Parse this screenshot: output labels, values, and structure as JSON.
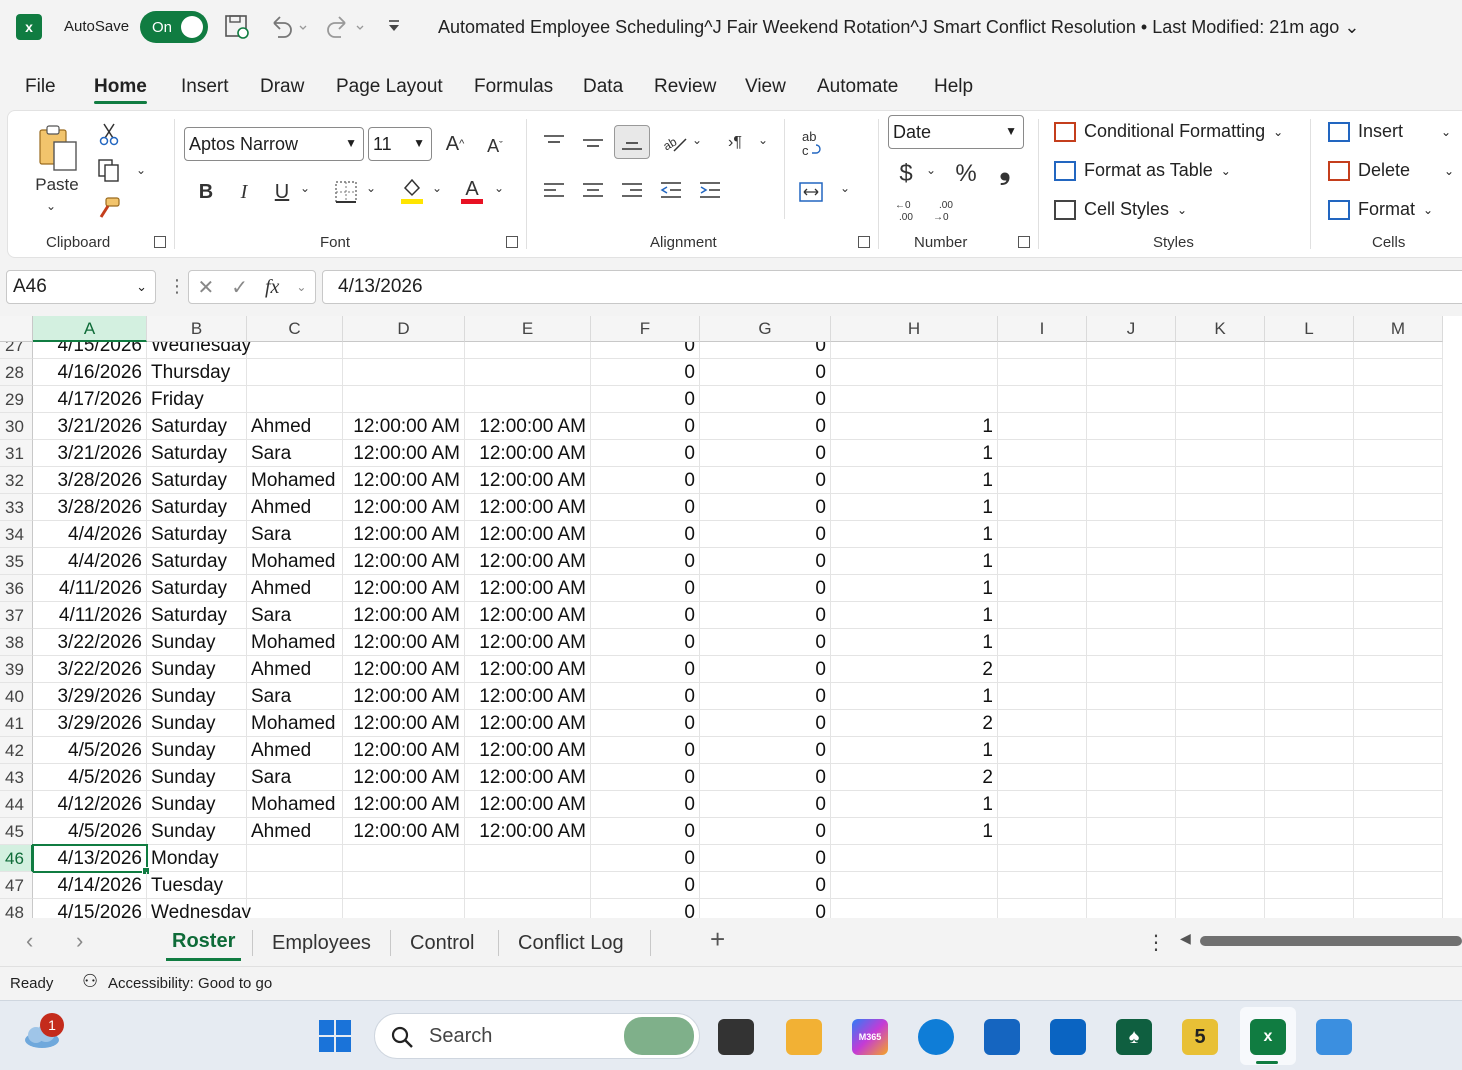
{
  "titlebar": {
    "autosave_label": "AutoSave",
    "autosave_state": "On",
    "document_title": "Automated Employee Scheduling^J  Fair Weekend Rotation^J  Smart Conflict Resolution • Last Modified: 21m ago",
    "title_chevron": "⌄"
  },
  "menu": [
    "File",
    "Home",
    "Insert",
    "Draw",
    "Page Layout",
    "Formulas",
    "Data",
    "Review",
    "View",
    "Automate",
    "Help"
  ],
  "ribbon": {
    "clipboard": {
      "paste": "Paste",
      "label": "Clipboard"
    },
    "font": {
      "name": "Aptos Narrow",
      "size": "11",
      "label": "Font",
      "bold": "B",
      "italic": "I",
      "underline": "U"
    },
    "alignment": {
      "label": "Alignment"
    },
    "number": {
      "format": "Date",
      "label": "Number",
      "currency": "$",
      "percent": "%",
      "comma": "❟"
    },
    "styles": {
      "conditional": "Conditional Formatting",
      "format_table": "Format as Table",
      "cell_styles": "Cell Styles",
      "label": "Styles"
    },
    "cells": {
      "insert": "Insert",
      "delete": "Delete",
      "format": "Format",
      "label": "Cells"
    }
  },
  "formula_bar": {
    "name_box": "A46",
    "value": "4/13/2026",
    "fx": "fx"
  },
  "columns": [
    "A",
    "B",
    "C",
    "D",
    "E",
    "F",
    "G",
    "H",
    "I",
    "J",
    "K",
    "L",
    "M"
  ],
  "rows": [
    {
      "n": "27",
      "a": "4/15/2026",
      "b": "Wednesday",
      "c": "",
      "d": "",
      "e": "",
      "f": "0",
      "g": "0",
      "h": ""
    },
    {
      "n": "28",
      "a": "4/16/2026",
      "b": "Thursday",
      "c": "",
      "d": "",
      "e": "",
      "f": "0",
      "g": "0",
      "h": ""
    },
    {
      "n": "29",
      "a": "4/17/2026",
      "b": "Friday",
      "c": "",
      "d": "",
      "e": "",
      "f": "0",
      "g": "0",
      "h": ""
    },
    {
      "n": "30",
      "a": "3/21/2026",
      "b": "Saturday",
      "c": "Ahmed",
      "d": "12:00:00 AM",
      "e": "12:00:00 AM",
      "f": "0",
      "g": "0",
      "h": "1"
    },
    {
      "n": "31",
      "a": "3/21/2026",
      "b": "Saturday",
      "c": "Sara",
      "d": "12:00:00 AM",
      "e": "12:00:00 AM",
      "f": "0",
      "g": "0",
      "h": "1"
    },
    {
      "n": "32",
      "a": "3/28/2026",
      "b": "Saturday",
      "c": "Mohamed",
      "d": "12:00:00 AM",
      "e": "12:00:00 AM",
      "f": "0",
      "g": "0",
      "h": "1"
    },
    {
      "n": "33",
      "a": "3/28/2026",
      "b": "Saturday",
      "c": "Ahmed",
      "d": "12:00:00 AM",
      "e": "12:00:00 AM",
      "f": "0",
      "g": "0",
      "h": "1"
    },
    {
      "n": "34",
      "a": "4/4/2026",
      "b": "Saturday",
      "c": "Sara",
      "d": "12:00:00 AM",
      "e": "12:00:00 AM",
      "f": "0",
      "g": "0",
      "h": "1"
    },
    {
      "n": "35",
      "a": "4/4/2026",
      "b": "Saturday",
      "c": "Mohamed",
      "d": "12:00:00 AM",
      "e": "12:00:00 AM",
      "f": "0",
      "g": "0",
      "h": "1"
    },
    {
      "n": "36",
      "a": "4/11/2026",
      "b": "Saturday",
      "c": "Ahmed",
      "d": "12:00:00 AM",
      "e": "12:00:00 AM",
      "f": "0",
      "g": "0",
      "h": "1"
    },
    {
      "n": "37",
      "a": "4/11/2026",
      "b": "Saturday",
      "c": "Sara",
      "d": "12:00:00 AM",
      "e": "12:00:00 AM",
      "f": "0",
      "g": "0",
      "h": "1"
    },
    {
      "n": "38",
      "a": "3/22/2026",
      "b": "Sunday",
      "c": "Mohamed",
      "d": "12:00:00 AM",
      "e": "12:00:00 AM",
      "f": "0",
      "g": "0",
      "h": "1"
    },
    {
      "n": "39",
      "a": "3/22/2026",
      "b": "Sunday",
      "c": "Ahmed",
      "d": "12:00:00 AM",
      "e": "12:00:00 AM",
      "f": "0",
      "g": "0",
      "h": "2"
    },
    {
      "n": "40",
      "a": "3/29/2026",
      "b": "Sunday",
      "c": "Sara",
      "d": "12:00:00 AM",
      "e": "12:00:00 AM",
      "f": "0",
      "g": "0",
      "h": "1"
    },
    {
      "n": "41",
      "a": "3/29/2026",
      "b": "Sunday",
      "c": "Mohamed",
      "d": "12:00:00 AM",
      "e": "12:00:00 AM",
      "f": "0",
      "g": "0",
      "h": "2"
    },
    {
      "n": "42",
      "a": "4/5/2026",
      "b": "Sunday",
      "c": "Ahmed",
      "d": "12:00:00 AM",
      "e": "12:00:00 AM",
      "f": "0",
      "g": "0",
      "h": "1"
    },
    {
      "n": "43",
      "a": "4/5/2026",
      "b": "Sunday",
      "c": "Sara",
      "d": "12:00:00 AM",
      "e": "12:00:00 AM",
      "f": "0",
      "g": "0",
      "h": "2"
    },
    {
      "n": "44",
      "a": "4/12/2026",
      "b": "Sunday",
      "c": "Mohamed",
      "d": "12:00:00 AM",
      "e": "12:00:00 AM",
      "f": "0",
      "g": "0",
      "h": "1"
    },
    {
      "n": "45",
      "a": "4/5/2026",
      "b": "Sunday",
      "c": "Ahmed",
      "d": "12:00:00 AM",
      "e": "12:00:00 AM",
      "f": "0",
      "g": "0",
      "h": "1"
    },
    {
      "n": "46",
      "a": "4/13/2026",
      "b": "Monday",
      "c": "",
      "d": "",
      "e": "",
      "f": "0",
      "g": "0",
      "h": ""
    },
    {
      "n": "47",
      "a": "4/14/2026",
      "b": "Tuesday",
      "c": "",
      "d": "",
      "e": "",
      "f": "0",
      "g": "0",
      "h": ""
    },
    {
      "n": "48",
      "a": "4/15/2026",
      "b": "Wednesday",
      "c": "",
      "d": "",
      "e": "",
      "f": "0",
      "g": "0",
      "h": ""
    }
  ],
  "sheets": [
    "Roster",
    "Employees",
    "Control",
    "Conflict Log"
  ],
  "status": {
    "ready": "Ready",
    "accessibility": "Accessibility: Good to go"
  },
  "taskbar": {
    "search_placeholder": "Search",
    "weather_badge": "1",
    "app5_label": "5",
    "m365_label": "M365"
  },
  "colors": {
    "excel_green": "#107c41",
    "selection_fill": "#d3f0e0"
  }
}
